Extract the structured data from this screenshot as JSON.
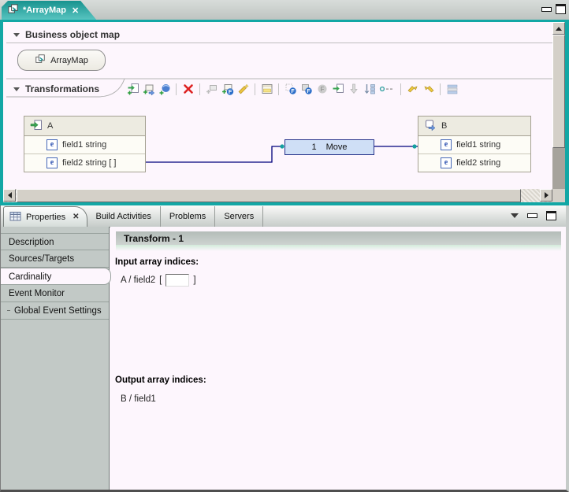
{
  "window": {
    "editor_tab": "*ArrayMap"
  },
  "editor": {
    "bom_section": "Business object map",
    "bom_button": "ArrayMap",
    "transformations_section": "Transformations",
    "toolbar_icons": [
      "add-transform",
      "add-custom-transform",
      "add-connection",
      "delete-transform",
      "add-move-disabled",
      "add-submap",
      "add-custom-mapping",
      "show-table-view",
      "source-f-filter",
      "target-f-filter",
      "f-disabled",
      "paste-transform",
      "move-down-disabled",
      "sort-transforms",
      "more-options",
      "go-to-next-source",
      "go-to-next-target",
      "show-transform-list"
    ],
    "source_box": {
      "title": "A",
      "fields": [
        "field1 string",
        "field2 string [ ]"
      ]
    },
    "transform_box": {
      "number": "1",
      "label": "Move"
    },
    "target_box": {
      "title": "B",
      "fields": [
        "field1 string",
        "field2 string"
      ]
    }
  },
  "properties": {
    "tabs": [
      "Properties",
      "Build Activities",
      "Problems",
      "Servers"
    ],
    "active_tab": "Properties",
    "sidebar": [
      "Description",
      "Sources/Targets",
      "Cardinality",
      "Event Monitor",
      "Global Event Settings"
    ],
    "active_sidebar": "Cardinality",
    "panel": {
      "title": "Transform - 1",
      "input_label": "Input array indices:",
      "input_path": "A / field2",
      "bracket_open": "[",
      "bracket_close": "]",
      "input_value": "",
      "output_label": "Output array indices:",
      "output_path": "B / field1"
    }
  },
  "colors": {
    "accent_teal": "#12a7a5",
    "connection": "#00007c",
    "transform_fill": "#cfdff6",
    "panel_bg": "#fdf6fd",
    "sidebar_bg": "#c2c9c6"
  }
}
